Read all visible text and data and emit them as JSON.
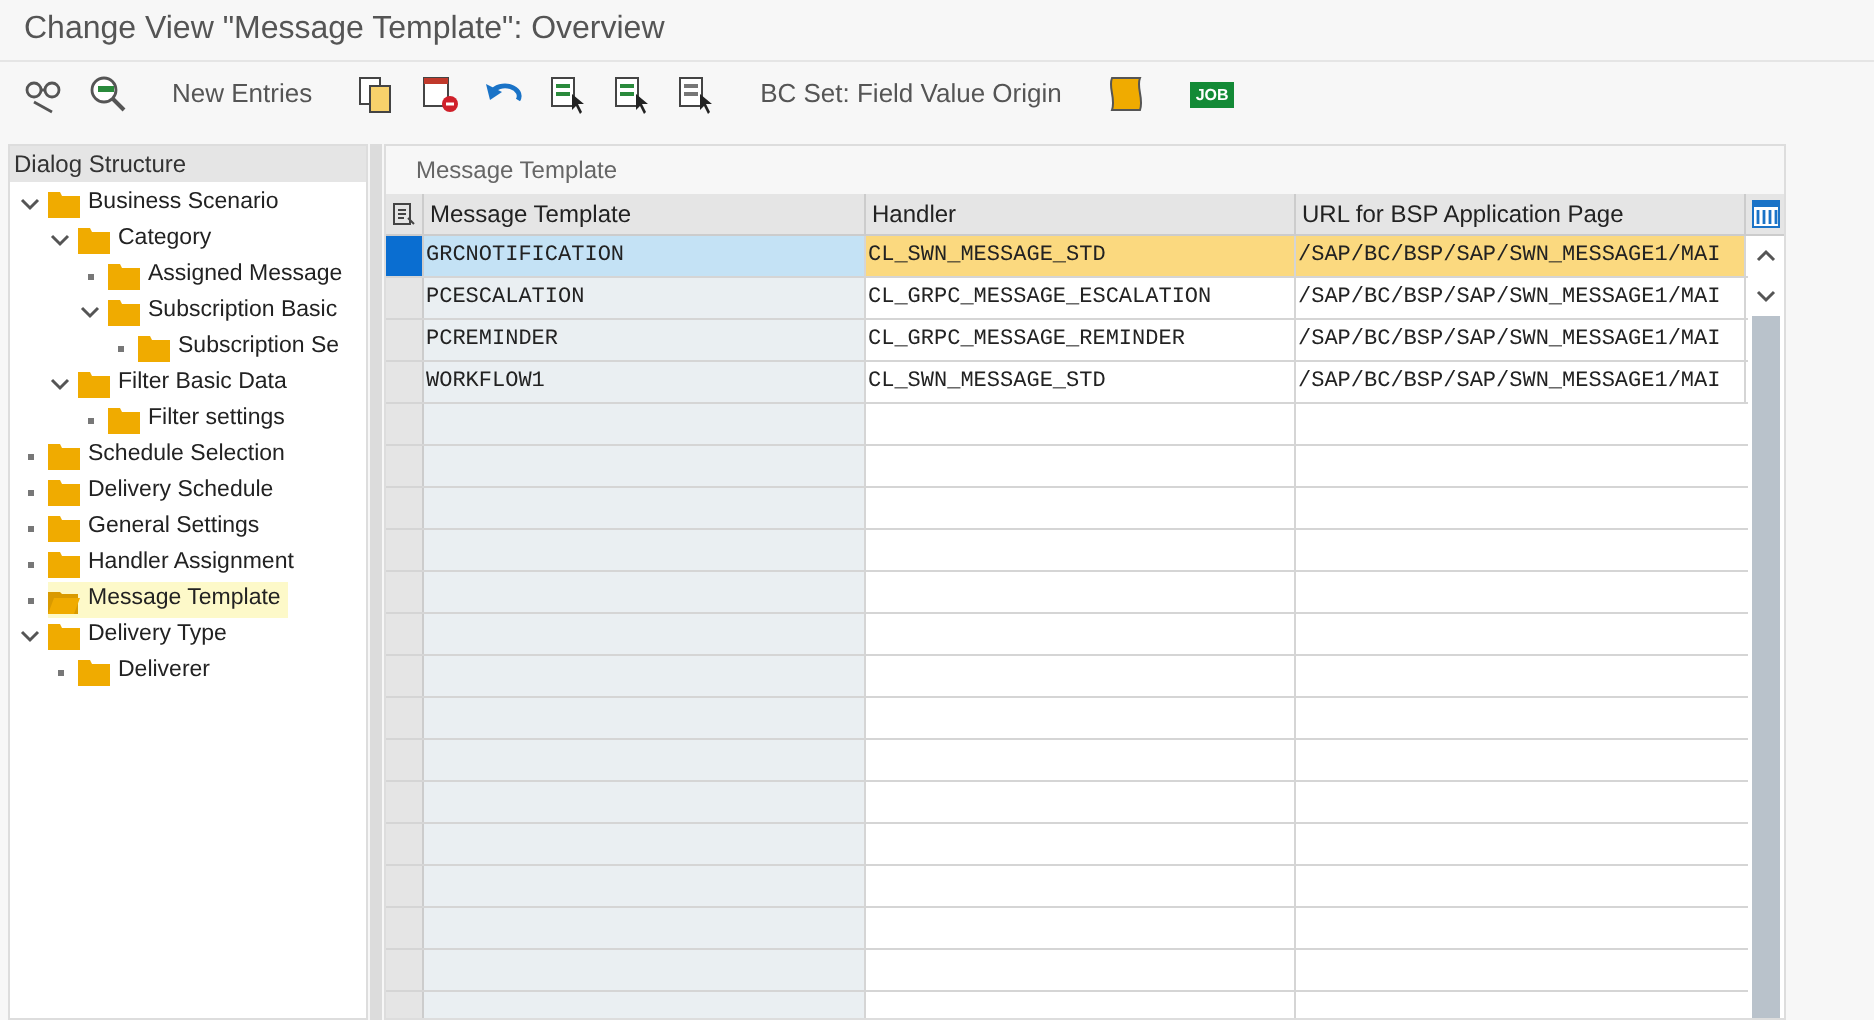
{
  "window": {
    "title": "Change View \"Message Template\": Overview"
  },
  "toolbar": {
    "new_entries": "New Entries",
    "bc_set": "BC Set: Field Value Origin",
    "job_label": "JOB"
  },
  "dialog_structure": {
    "title": "Dialog Structure",
    "items": [
      {
        "label": "Business Scenario",
        "expanded": true,
        "selected": false,
        "children": [
          {
            "label": "Category",
            "expanded": true,
            "selected": false,
            "children": [
              {
                "label": "Assigned Message",
                "selected": false
              },
              {
                "label": "Subscription Basic",
                "expanded": true,
                "selected": false,
                "children": [
                  {
                    "label": "Subscription Se",
                    "selected": false
                  }
                ]
              }
            ]
          },
          {
            "label": "Filter Basic Data",
            "expanded": true,
            "selected": false,
            "children": [
              {
                "label": "Filter settings",
                "selected": false
              }
            ]
          }
        ]
      },
      {
        "label": "Schedule Selection",
        "selected": false
      },
      {
        "label": "Delivery Schedule",
        "selected": false
      },
      {
        "label": "General Settings",
        "selected": false
      },
      {
        "label": "Handler Assignment",
        "selected": false
      },
      {
        "label": "Message Template",
        "selected": true
      },
      {
        "label": "Delivery Type",
        "expanded": true,
        "selected": false,
        "children": [
          {
            "label": "Deliverer",
            "selected": false
          }
        ]
      }
    ]
  },
  "table": {
    "title": "Message Template",
    "columns": [
      "Message Template",
      "Handler",
      "URL for BSP Application Page"
    ],
    "rows": [
      {
        "selected": true,
        "cells": [
          "GRCNOTIFICATION",
          "CL_SWN_MESSAGE_STD",
          "/SAP/BC/BSP/SAP/SWN_MESSAGE1/MAI"
        ]
      },
      {
        "selected": false,
        "cells": [
          "PCESCALATION",
          "CL_GRPC_MESSAGE_ESCALATION",
          "/SAP/BC/BSP/SAP/SWN_MESSAGE1/MAI"
        ]
      },
      {
        "selected": false,
        "cells": [
          "PCREMINDER",
          "CL_GRPC_MESSAGE_REMINDER",
          "/SAP/BC/BSP/SAP/SWN_MESSAGE1/MAI"
        ]
      },
      {
        "selected": false,
        "cells": [
          "WORKFLOW1",
          "CL_SWN_MESSAGE_STD",
          "/SAP/BC/BSP/SAP/SWN_MESSAGE1/MAI"
        ]
      }
    ]
  }
}
